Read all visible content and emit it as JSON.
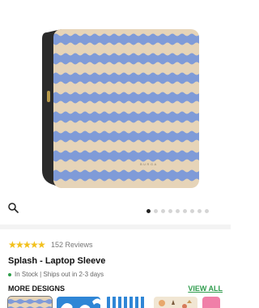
{
  "product": {
    "image_alt": "Splash laptop sleeve with blue and beige wavy stripes",
    "brand_mark": "BURGA",
    "colors": {
      "stripe_blue": "#7f9bd8",
      "stripe_beige": "#e6d4b8",
      "body_dark": "#2b2b2b"
    }
  },
  "gallery": {
    "zoom_icon": "search-icon",
    "active_index": 0,
    "image_count": 9
  },
  "rating": {
    "stars": 5,
    "review_label": "152 Reviews",
    "star_color": "#f2c01b"
  },
  "title": "Splash - Laptop Sleeve",
  "stock": {
    "text": "In Stock | Ships out in 2-3 days",
    "dot_color": "#2e9e4a"
  },
  "more_designs": {
    "heading": "MORE DESIGNS",
    "view_all_label": "VIEW ALL",
    "thumbnails": [
      {
        "name": "splash",
        "selected": true
      },
      {
        "name": "blue-waves"
      },
      {
        "name": "blue-stripes"
      },
      {
        "name": "beach-shells"
      },
      {
        "name": "pink"
      }
    ]
  }
}
